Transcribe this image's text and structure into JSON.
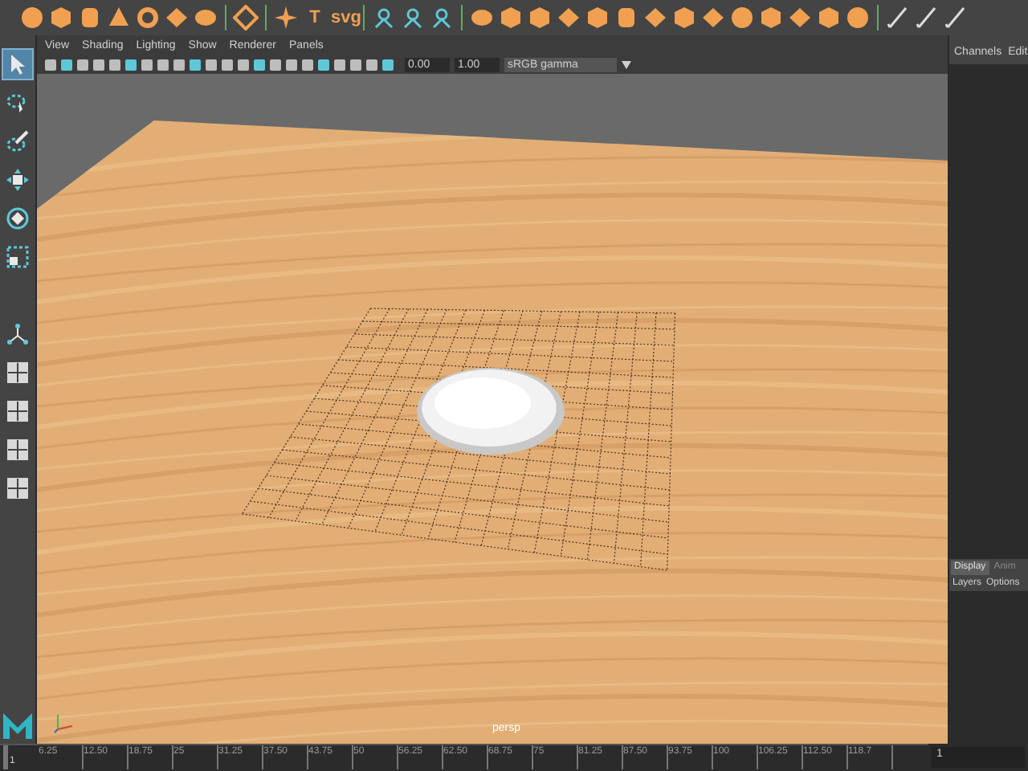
{
  "shelf": [
    {
      "kind": "sphere"
    },
    {
      "kind": "cube"
    },
    {
      "kind": "cylinder"
    },
    {
      "kind": "cone"
    },
    {
      "kind": "torus"
    },
    {
      "kind": "plane"
    },
    {
      "kind": "disc"
    },
    {
      "kind": "sep"
    },
    {
      "kind": "poly"
    },
    {
      "kind": "sep"
    },
    {
      "kind": "star"
    },
    {
      "kind": "text",
      "label": "T"
    },
    {
      "kind": "text",
      "label": "svg"
    },
    {
      "kind": "sep"
    },
    {
      "kind": "node"
    },
    {
      "kind": "node"
    },
    {
      "kind": "node"
    },
    {
      "kind": "sep"
    },
    {
      "kind": "disc"
    },
    {
      "kind": "cube"
    },
    {
      "kind": "cube"
    },
    {
      "kind": "plane"
    },
    {
      "kind": "cube"
    },
    {
      "kind": "cylinder"
    },
    {
      "kind": "plane"
    },
    {
      "kind": "cube"
    },
    {
      "kind": "plane"
    },
    {
      "kind": "sphere"
    },
    {
      "kind": "cube"
    },
    {
      "kind": "plane"
    },
    {
      "kind": "cube"
    },
    {
      "kind": "sphere"
    },
    {
      "kind": "sep"
    },
    {
      "kind": "pen"
    },
    {
      "kind": "pen"
    },
    {
      "kind": "pen"
    }
  ],
  "menu": [
    "View",
    "Shading",
    "Lighting",
    "Show",
    "Renderer",
    "Panels"
  ],
  "view_toolbar": {
    "exposure": "0.00",
    "gamma": "1.00",
    "color_space": "sRGB gamma"
  },
  "viewport_label": "persp",
  "tools": [
    {
      "kind": "select",
      "selected": true
    },
    {
      "kind": "lasso",
      "selected": false
    },
    {
      "kind": "paint",
      "selected": false
    },
    {
      "kind": "move",
      "selected": false
    },
    {
      "kind": "rotate",
      "selected": false
    },
    {
      "kind": "scale",
      "selected": false
    },
    {
      "kind": "axis",
      "selected": false
    },
    {
      "kind": "layout",
      "selected": false
    },
    {
      "kind": "layout",
      "selected": false
    },
    {
      "kind": "layout",
      "selected": false
    },
    {
      "kind": "layout",
      "selected": false
    }
  ],
  "channel_tabs": [
    "Channels",
    "Edit"
  ],
  "layer_tabs": [
    {
      "label": "Display",
      "selected": true
    },
    {
      "label": "Anim",
      "selected": false
    }
  ],
  "layer_menu": [
    "Layers",
    "Options"
  ],
  "timeline": {
    "start": "1",
    "ticks": [
      "6.25",
      "12.50",
      "18.75",
      "25",
      "31.25",
      "37.50",
      "43.75",
      "50",
      "56.25",
      "62.50",
      "68.75",
      "75",
      "81.25",
      "87.50",
      "93.75",
      "100",
      "106.25",
      "112.50",
      "118.7"
    ],
    "current_frame": "1",
    "level": 0
  }
}
